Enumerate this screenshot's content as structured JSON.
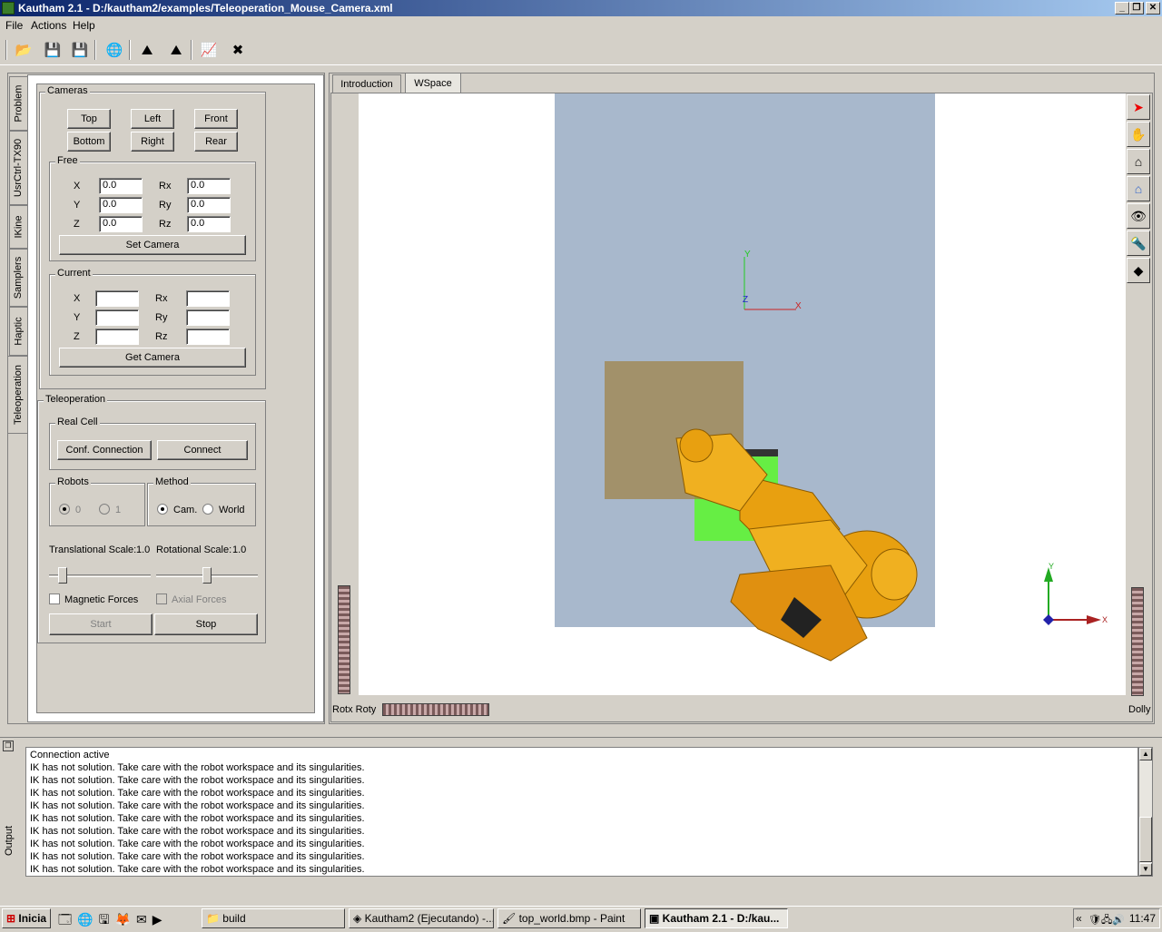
{
  "window": {
    "title": "Kautham 2.1 - D:/kautham2/examples/Teleoperation_Mouse_Camera.xml",
    "minimize": "_",
    "maximize": "❐",
    "close": "✕"
  },
  "menu": [
    "File",
    "Actions",
    "Help"
  ],
  "left_tabs": [
    "Problem",
    "UsrCtrl-TX90",
    "IKine",
    "Samplers",
    "Haptic",
    "Teleoperation"
  ],
  "cameras": {
    "title": "Cameras",
    "buttons": [
      "Top",
      "Left",
      "Front",
      "Bottom",
      "Right",
      "Rear"
    ],
    "free": {
      "title": "Free",
      "labels": [
        "X",
        "Y",
        "Z",
        "Rx",
        "Ry",
        "Rz"
      ],
      "values": [
        "0.0",
        "0.0",
        "0.0",
        "0.0",
        "0.0",
        "0.0"
      ],
      "set_button": "Set Camera"
    },
    "current": {
      "title": "Current",
      "labels": [
        "X",
        "Y",
        "Z",
        "Rx",
        "Ry",
        "Rz"
      ],
      "values": [
        "",
        "",
        "",
        "",
        "",
        ""
      ],
      "get_button": "Get Camera"
    }
  },
  "teleop": {
    "title": "Teleoperation",
    "real_cell": {
      "title": "Real Cell",
      "conf_button": "Conf. Connection",
      "connect_button": "Connect"
    },
    "robots": {
      "title": "Robots",
      "options": [
        "0",
        "1"
      ],
      "selected": "0"
    },
    "method": {
      "title": "Method",
      "options": [
        "Cam.",
        "World"
      ],
      "selected": "Cam."
    },
    "trans_scale_label": "Translational Scale:",
    "trans_scale_value": "1.0",
    "rot_scale_label": "Rotational Scale:",
    "rot_scale_value": "1.0",
    "trans_slider_level": 0.1,
    "rot_slider_level": 0.5,
    "magnetic_label": "Magnetic Forces",
    "axial_label": "Axial Forces",
    "start_button": "Start",
    "stop_button": "Stop"
  },
  "view_tabs": [
    "Introduction",
    "WSpace"
  ],
  "viewer": {
    "rot_label": "Rotx Roty",
    "dolly_label": "Dolly",
    "axis_labels": {
      "x": "X",
      "y": "Y",
      "z": "Z"
    },
    "colors": {
      "background": "#a8b8cc",
      "obstacle": "#66ee44",
      "robot": "#e8a010",
      "box": "#a08040"
    }
  },
  "output": {
    "title": "Output",
    "lines": [
      "Connection active",
      "IK has not solution. Take care with the robot workspace and its singularities.",
      "IK has not solution. Take care with the robot workspace and its singularities.",
      "IK has not solution. Take care with the robot workspace and its singularities.",
      "IK has not solution. Take care with the robot workspace and its singularities.",
      "IK has not solution. Take care with the robot workspace and its singularities.",
      "IK has not solution. Take care with the robot workspace and its singularities.",
      "IK has not solution. Take care with the robot workspace and its singularities.",
      "IK has not solution. Take care with the robot workspace and its singularities.",
      "IK has not solution. Take care with the robot workspace and its singularities."
    ]
  },
  "taskbar": {
    "start": "Inicia",
    "tasks": [
      "build",
      "Kautham2 (Ejecutando) -...",
      "top_world.bmp - Paint",
      "Kautham 2.1 - D:/kau..."
    ],
    "clock": "11:47"
  }
}
